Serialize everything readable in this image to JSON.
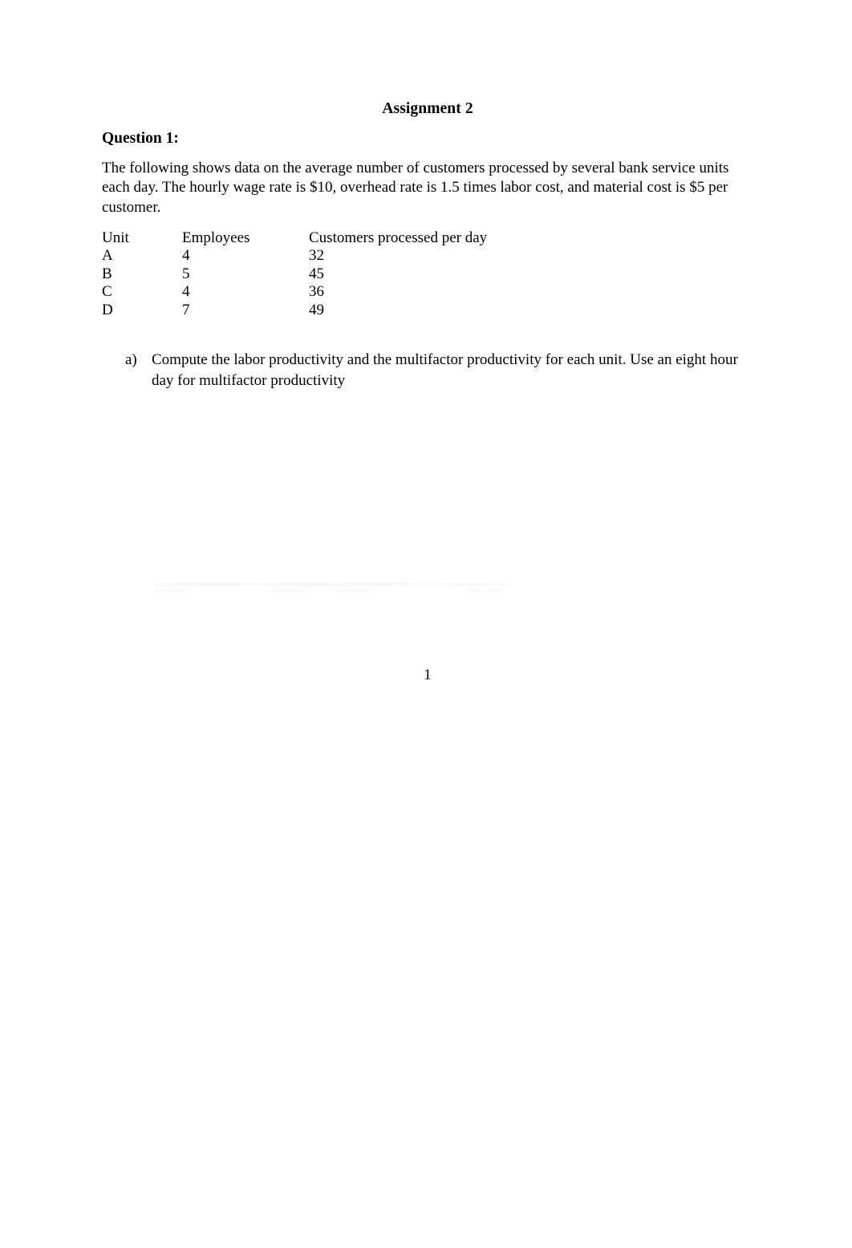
{
  "document": {
    "title": "Assignment 2",
    "question_heading": "Question 1:",
    "intro_paragraph": "The following shows data on the average number of customers processed by several bank service units each day. The hourly wage rate is $10, overhead rate is 1.5 times labor cost, and material cost is $5 per customer.",
    "page_number": "1"
  },
  "table": {
    "headers": {
      "unit": "Unit",
      "employees": "Employees",
      "customers": "Customers processed per day"
    },
    "rows": [
      {
        "unit": "A",
        "employees": "4",
        "customers": "32"
      },
      {
        "unit": "B",
        "employees": "5",
        "customers": "45"
      },
      {
        "unit": "C",
        "employees": "4",
        "customers": "36"
      },
      {
        "unit": "D",
        "employees": "7",
        "customers": "49"
      }
    ]
  },
  "tasks": [
    {
      "marker": "a)",
      "text": "Compute the labor productivity and the multifactor productivity for each unit. Use an eight hour day for multifactor productivity"
    }
  ]
}
